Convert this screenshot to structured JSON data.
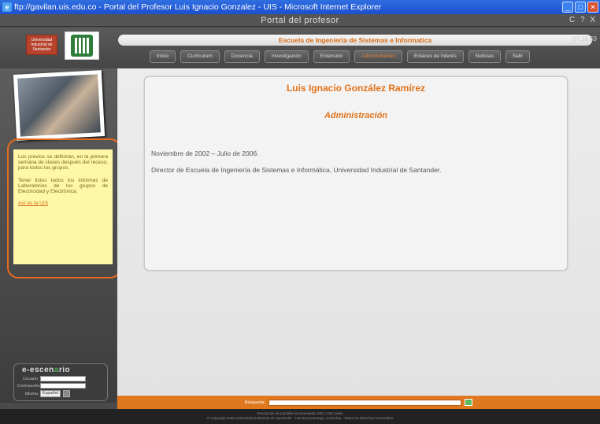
{
  "window": {
    "title": "ftp://gavilan.uis.edu.co - Portal del Profesor Luis Ignacio Gonzalez - UIS - Microsoft Internet Explorer",
    "controls": [
      "_",
      "□",
      "✕"
    ]
  },
  "topbar": {
    "title": "Portal del profesor",
    "right": "C ? X"
  },
  "header": {
    "logo_text": "Universidad Industrial de Santander",
    "school": "Escuela de Ingenieria de Sistemas e Informatica",
    "clock": "07:16:59"
  },
  "nav": [
    "Inicio",
    "Curriculum",
    "Docencia",
    "Investigación",
    "Extensión",
    "Administración",
    "Enlaces de Interés",
    "Noticias",
    "Salir"
  ],
  "nav_active": "Administración",
  "note": {
    "p1": "Los previos se definirán, en la primera semana de clases después del receso, para todos los grupos.",
    "p2": "Tener listos todos los informes de Laboratorios de los grupos de Electricidad y Electrónica.",
    "link": "Así es la UIS"
  },
  "login": {
    "brand_a": "e-escen",
    "brand_b": "a",
    "brand_c": "rio",
    "user_label": "Usuario",
    "pass_label": "Contraseña",
    "lang_label": "Idioma",
    "lang_value": "Español"
  },
  "content": {
    "name": "Luis Ignacio González Ramírez",
    "role": "Administración",
    "period": "Noviembre de 2002 – Julio de 2006.",
    "position": "Director de Escuela de Ingeniería de Sistemas e Informática,  Universidad Industrial de Santander."
  },
  "search": {
    "label": "Búsqueda:"
  },
  "footer": {
    "line1": "Resolución de pantalla recomendada: 800 x 600 pixels",
    "line2": "© Copyright 2006 Universidad Industrial de Santander - UIS Bucaramanga, Colombia - Todos los derechos reservados"
  },
  "colors": {
    "accent": "#e0731c",
    "chrome": "#4a4a4a",
    "note_bg": "#fff7a8"
  }
}
